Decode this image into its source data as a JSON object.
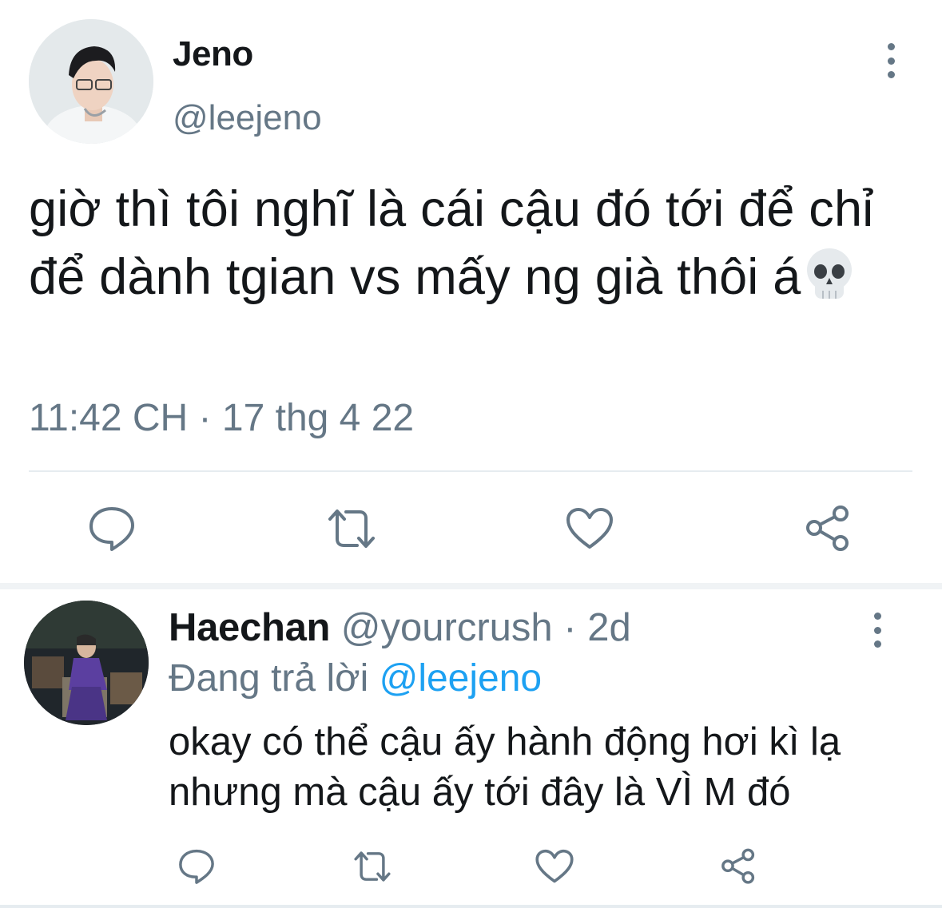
{
  "main_tweet": {
    "name": "Jeno",
    "handle": "@leejeno",
    "text": "giờ thì tôi nghĩ là cái cậu đó tới để chỉ để dành tgian vs mấy ng già thôi á",
    "emoji_icon": "skull-emoji",
    "timestamp": "11:42 CH · 17 thg 4 22",
    "actions": [
      "reply-icon",
      "retweet-icon",
      "like-icon",
      "share-icon"
    ]
  },
  "reply_tweet": {
    "name": "Haechan",
    "handle": "@yourcrush",
    "age": "· 2d",
    "replying_prefix": "Đang trả lời",
    "replying_to": "@leejeno",
    "text_line1": "okay có thể cậu ấy hành động hơi kì lạ",
    "text_line2": "nhưng mà cậu ấy tới đây là VÌ M đó",
    "actions": [
      "reply-icon",
      "retweet-icon",
      "like-icon",
      "share-icon"
    ]
  },
  "colors": {
    "text": "#14171a",
    "secondary": "#657786",
    "link": "#1da1f2",
    "divider": "#e6ecf0"
  }
}
